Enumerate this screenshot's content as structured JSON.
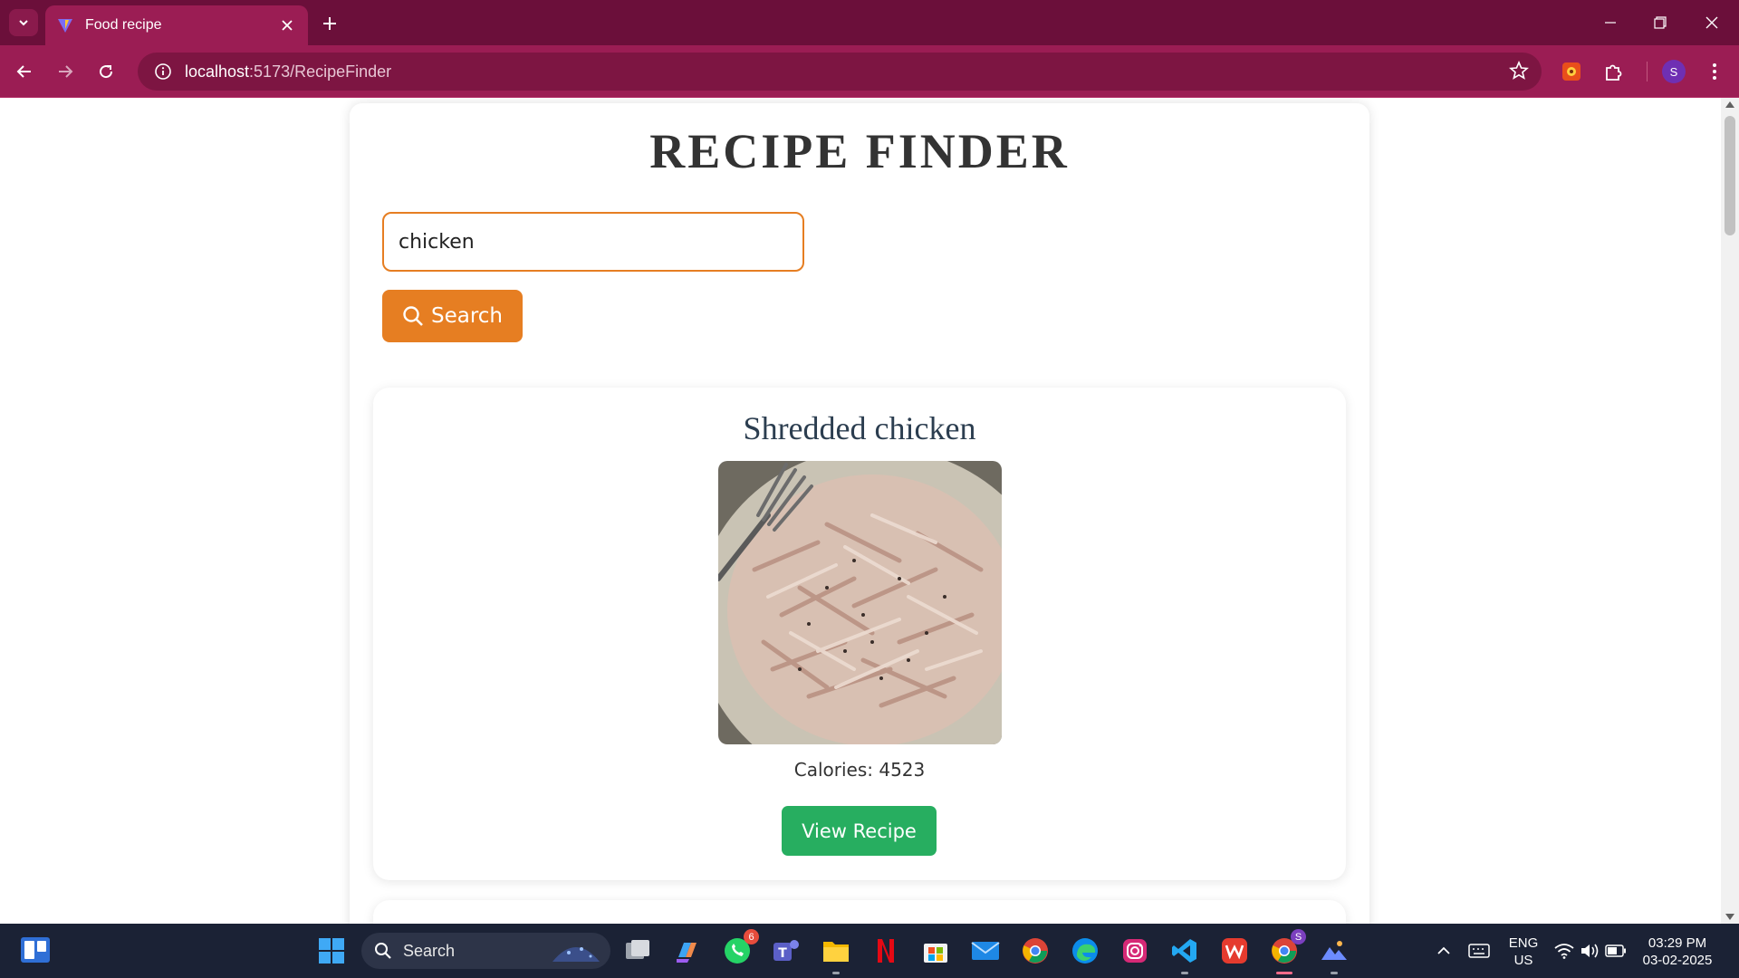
{
  "browser": {
    "tab_title": "Food recipe",
    "url_host": "localhost",
    "url_path": ":5173/RecipeFinder",
    "profile_initial": "S",
    "theme_color": "#9b1d54"
  },
  "page": {
    "title": "RECIPE FINDER",
    "search": {
      "value": "chicken",
      "button_label": "Search"
    },
    "recipes": [
      {
        "name": "Shredded chicken",
        "calories_text": "Calories: 4523",
        "button_label": "View Recipe"
      },
      {
        "name": "",
        "calories_text": "",
        "button_label": ""
      }
    ],
    "accent_color": "#e67e22",
    "button_color": "#27ae60"
  },
  "taskbar": {
    "search_label": "Search",
    "whatsapp_badge": "6",
    "chrome_badge": "S",
    "language": "ENG",
    "region": "US",
    "time": "03:29 PM",
    "date": "03-02-2025"
  }
}
